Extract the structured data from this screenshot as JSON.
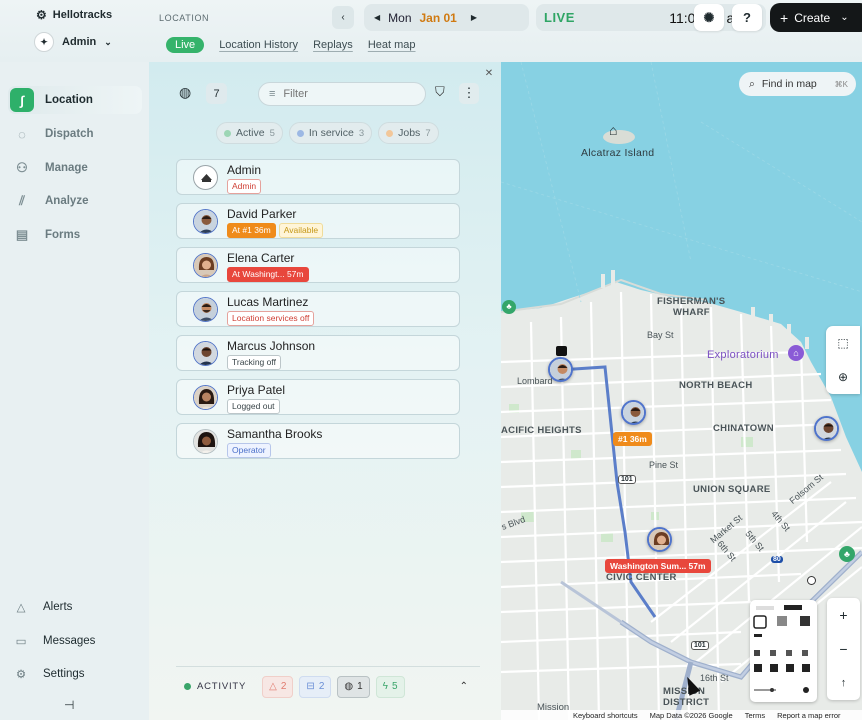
{
  "header": {
    "org_name": "Hellotracks",
    "user_name": "Admin",
    "breadcrumb": "LOCATION",
    "tabs": [
      {
        "label": "Live",
        "active": true
      },
      {
        "label": "Location History"
      },
      {
        "label": "Replays"
      },
      {
        "label": "Heat map"
      }
    ],
    "day": "Mon",
    "date": "Jan 01",
    "live_label": "LIVE",
    "time": "11:06:00 am",
    "help_label": "?",
    "create_label": "Create"
  },
  "sidebar": {
    "items": [
      {
        "label": "Location",
        "icon": "route-icon",
        "active": true
      },
      {
        "label": "Dispatch",
        "icon": "chat-icon"
      },
      {
        "label": "Manage",
        "icon": "users-icon"
      },
      {
        "label": "Analyze",
        "icon": "chart-icon"
      },
      {
        "label": "Forms",
        "icon": "clipboard-icon"
      }
    ],
    "bottom": [
      {
        "label": "Alerts",
        "icon": "warning-icon"
      },
      {
        "label": "Messages",
        "icon": "message-icon"
      },
      {
        "label": "Settings",
        "icon": "gear-icon"
      }
    ]
  },
  "panel": {
    "count": "7",
    "filter_placeholder": "Filter",
    "chips": [
      {
        "label": "Active",
        "count": "5",
        "color": "#9dd6b5"
      },
      {
        "label": "In service",
        "count": "3",
        "color": "#9cb8e4"
      },
      {
        "label": "Jobs",
        "count": "7",
        "color": "#f2c79a"
      }
    ],
    "members": [
      {
        "name": "Admin",
        "tags": [
          {
            "text": "Admin",
            "style": "redo"
          }
        ]
      },
      {
        "name": "David Parker",
        "tags": [
          {
            "text": "At #1 36m",
            "style": "orange"
          },
          {
            "text": "Available",
            "style": "yellow"
          }
        ]
      },
      {
        "name": "Elena Carter",
        "tags": [
          {
            "text": "At Washingt... 57m",
            "style": "red"
          }
        ]
      },
      {
        "name": "Lucas Martinez",
        "tags": [
          {
            "text": "Location services off",
            "style": "redo"
          }
        ]
      },
      {
        "name": "Marcus Johnson",
        "tags": [
          {
            "text": "Tracking off",
            "style": "grey"
          }
        ]
      },
      {
        "name": "Priya Patel",
        "tags": [
          {
            "text": "Logged out",
            "style": "grey"
          }
        ]
      },
      {
        "name": "Samantha Brooks",
        "tags": [
          {
            "text": "Operator",
            "style": "blue"
          }
        ]
      }
    ],
    "activity": {
      "label": "ACTIVITY",
      "counts": [
        {
          "value": "2",
          "icon": "warning-icon",
          "color": "#e07a6e"
        },
        {
          "value": "2",
          "icon": "form-icon",
          "color": "#6b8fd6"
        },
        {
          "value": "1",
          "icon": "message-icon",
          "color": "#333"
        },
        {
          "value": "5",
          "icon": "bolt-icon",
          "color": "#3aa56a"
        }
      ]
    }
  },
  "map": {
    "search_placeholder": "Find in map",
    "search_shortcut": "⌘K",
    "labels": {
      "alcatraz": "Alcatraz Island",
      "fishermans": "FISHERMAN'S",
      "wharf": "WHARF",
      "exploratorium": "Exploratorium",
      "north_beach": "NORTH BEACH",
      "chinatown": "CHINATOWN",
      "pacific_heights": "ACIFIC HEIGHTS",
      "union_square": "UNION SQUARE",
      "civic_center": "CIVIC CENTER",
      "mission_district_1": "MISSION",
      "mission_district_2": "DISTRICT",
      "mission": "Mission",
      "bay_st": "Bay St",
      "lombard": "Lombard",
      "pine_st": "Pine St",
      "market_st": "Market St",
      "folsom_st": "Folsom St",
      "fourth_st": "4th St",
      "fifth_st": "5th St",
      "sixth_st": "6th St",
      "sixteenth_st": "16th St",
      "s_blvd": "s Blvd",
      "hwy_101a": "101",
      "hwy_101b": "101",
      "hwy_80": "80"
    },
    "flags": [
      {
        "text": "#1 36m",
        "color": "#ef8b1b"
      },
      {
        "text": "Washington Sum... 57m",
        "color": "#e8473c"
      }
    ],
    "attribution": [
      "Keyboard shortcuts",
      "Map Data ©2026 Google",
      "Terms",
      "Report a map error"
    ],
    "colors": {
      "water": "#87d1e3",
      "land": "#e7eae7",
      "road": "#b8c4d8",
      "route": "#5b7ec9"
    }
  }
}
